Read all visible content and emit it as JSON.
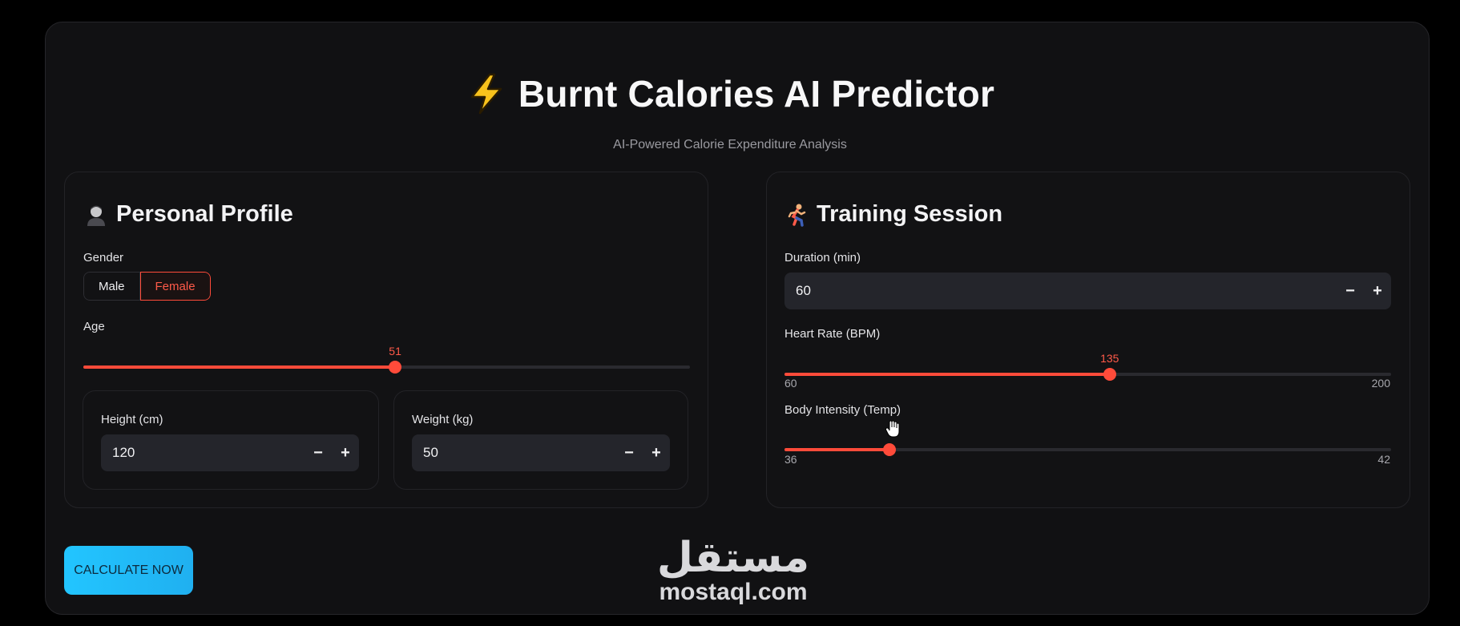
{
  "header": {
    "title": "Burnt Calories AI Predictor",
    "subtitle": "AI-Powered Calorie Expenditure Analysis",
    "icon": "lightning-bolt-icon"
  },
  "profile": {
    "title": "Personal Profile",
    "icon": "person-icon",
    "gender": {
      "label": "Gender",
      "options": [
        "Male",
        "Female"
      ],
      "selected": "Female"
    },
    "age": {
      "label": "Age",
      "value": "51",
      "fraction": 0.514
    },
    "height": {
      "label": "Height (cm)",
      "value": "120"
    },
    "weight": {
      "label": "Weight (kg)",
      "value": "50"
    }
  },
  "training": {
    "title": "Training Session",
    "icon": "runner-icon",
    "duration": {
      "label": "Duration (min)",
      "value": "60"
    },
    "heart_rate": {
      "label": "Heart Rate (BPM)",
      "value": "135",
      "min": "60",
      "max": "200",
      "fraction": 0.536
    },
    "body_temp": {
      "label": "Body Intensity (Temp)",
      "min": "36",
      "max": "42",
      "fraction": 0.173
    }
  },
  "actions": {
    "calculate": "CALCULATE NOW"
  },
  "stepper": {
    "minus": "−",
    "plus": "+"
  },
  "watermark": {
    "arabic": "مستقل",
    "latin": "mostaql.com"
  },
  "colors": {
    "accent": "#ff4b3a",
    "button": "#22c5ff",
    "background": "#111113"
  }
}
